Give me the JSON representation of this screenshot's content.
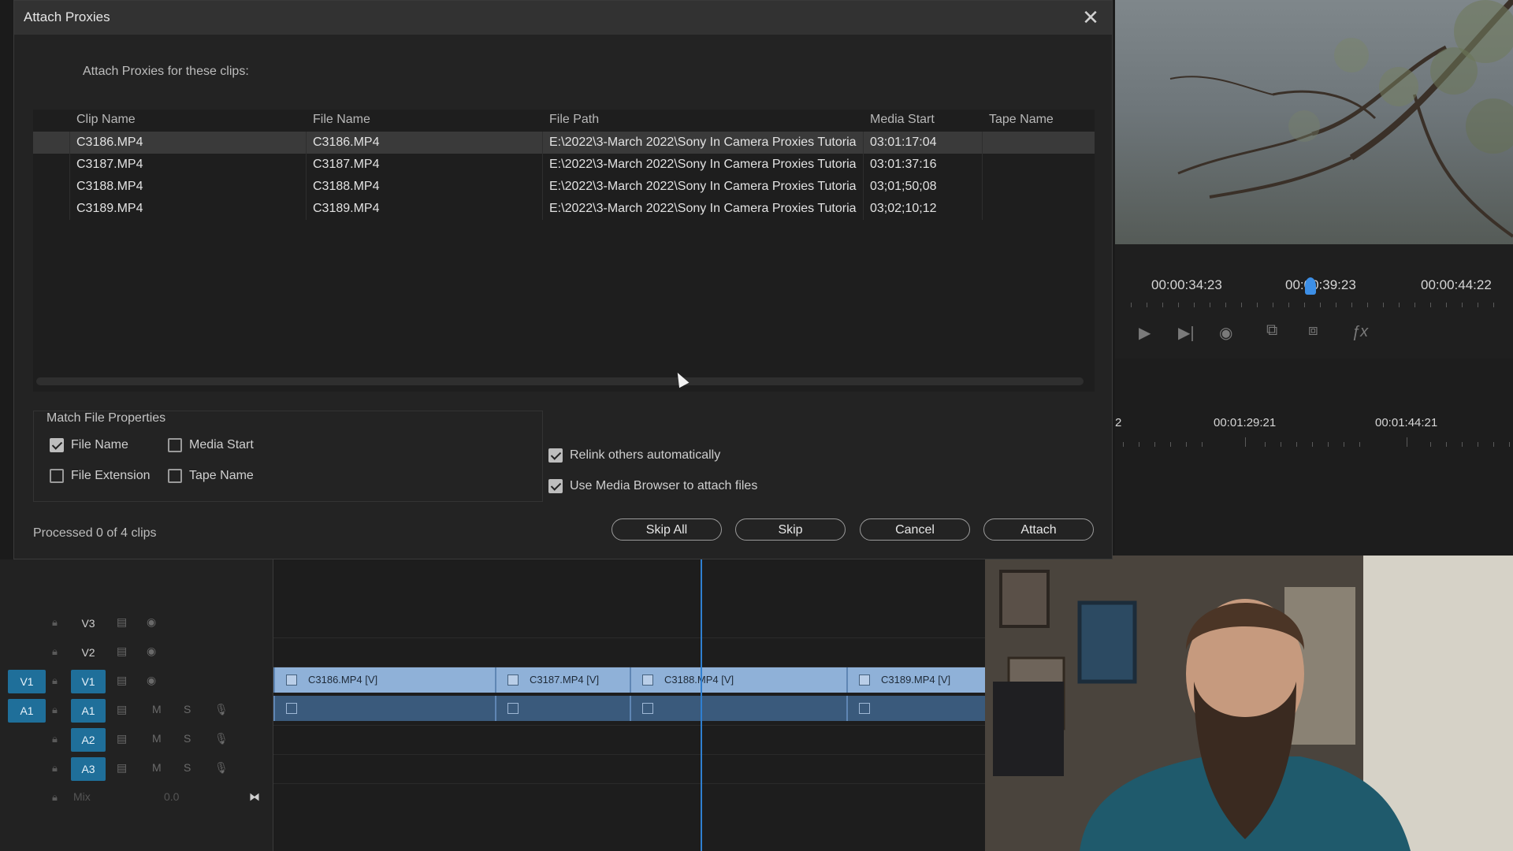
{
  "dialog": {
    "title": "Attach Proxies",
    "subtitle": "Attach Proxies for these clips:",
    "columns": [
      "Clip Name",
      "File Name",
      "File Path",
      "Media Start",
      "Tape Name"
    ],
    "rows": [
      {
        "clip": "C3186.MP4",
        "file": "C3186.MP4",
        "path": "E:\\2022\\3-March 2022\\Sony In Camera Proxies Tutoria",
        "start": "03:01:17:04",
        "tape": ""
      },
      {
        "clip": "C3187.MP4",
        "file": "C3187.MP4",
        "path": "E:\\2022\\3-March 2022\\Sony In Camera Proxies Tutoria",
        "start": "03:01:37:16",
        "tape": ""
      },
      {
        "clip": "C3188.MP4",
        "file": "C3188.MP4",
        "path": "E:\\2022\\3-March 2022\\Sony In Camera Proxies Tutoria",
        "start": "03;01;50;08",
        "tape": ""
      },
      {
        "clip": "C3189.MP4",
        "file": "C3189.MP4",
        "path": "E:\\2022\\3-March 2022\\Sony In Camera Proxies Tutoria",
        "start": "03;02;10;12",
        "tape": ""
      }
    ],
    "match_group_label": "Match File Properties",
    "checkboxes": {
      "file_name": {
        "label": "File Name",
        "checked": true
      },
      "media_start": {
        "label": "Media Start",
        "checked": false
      },
      "file_extension": {
        "label": "File Extension",
        "checked": false
      },
      "tape_name": {
        "label": "Tape Name",
        "checked": false
      },
      "relink_auto": {
        "label": "Relink others automatically",
        "checked": true
      },
      "use_media_browser": {
        "label": "Use Media Browser to attach files",
        "checked": true
      }
    },
    "status": "Processed 0 of 4 clips",
    "buttons": {
      "skip_all": "Skip All",
      "skip": "Skip",
      "cancel": "Cancel",
      "attach": "Attach"
    }
  },
  "program_monitor": {
    "timecodes": [
      "00:00:34:23",
      "00:00:39:23",
      "00:00:44:22"
    ],
    "sequence_ruler": [
      "2",
      "00:01:29:21",
      "00:01:44:21"
    ]
  },
  "timeline": {
    "tracks": [
      {
        "source": "",
        "name": "V3"
      },
      {
        "source": "",
        "name": "V2"
      },
      {
        "source": "V1",
        "name": "V1"
      },
      {
        "source": "A1",
        "name": "A1"
      },
      {
        "source": "",
        "name": "A2"
      },
      {
        "source": "",
        "name": "A3"
      }
    ],
    "mix_label": "Mix",
    "mix_value": "0.0",
    "mute_label": "M",
    "solo_label": "S",
    "video_clips": [
      "C3186.MP4 [V]",
      "C3187.MP4 [V]",
      "C3188.MP4 [V]",
      "C3189.MP4 [V]"
    ]
  },
  "colors": {
    "accent": "#1f6f9a",
    "video_clip": "#8fb1d8",
    "audio_clip": "#3a5a7c",
    "playhead": "#2f7fd0"
  }
}
